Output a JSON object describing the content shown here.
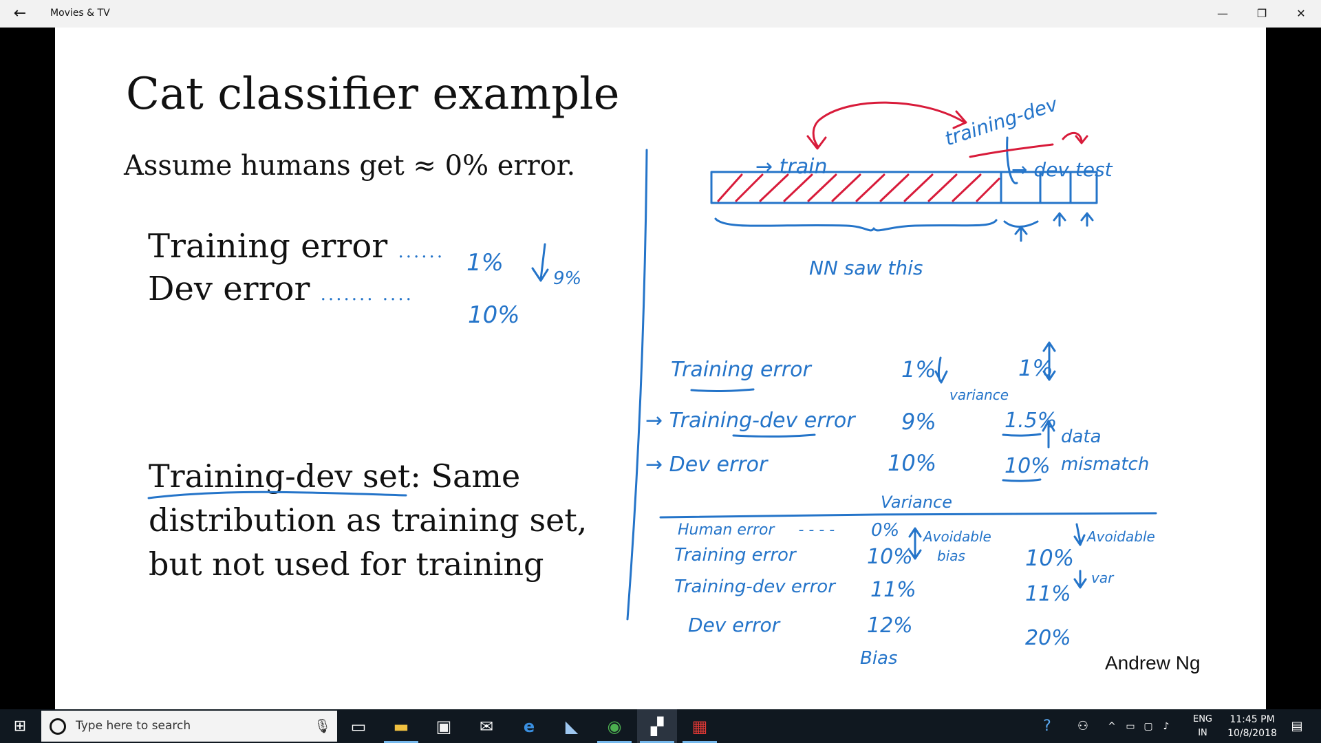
{
  "window": {
    "title": "Movies & TV",
    "back_icon": "arrow-left-icon",
    "minimize_glyph": "—",
    "maximize_glyph": "❐",
    "close_glyph": "✕"
  },
  "slide": {
    "title": "Cat classifier example",
    "assumption": "Assume humans get ≈ 0% error.",
    "training_error_label": "Training error",
    "training_error_dots": "......",
    "dev_error_label": "Dev error",
    "dev_error_dots": "....... ....",
    "training_dev_definition": "Training-dev set: Same distribution as training set, but not used for training",
    "author": "Andrew Ng"
  },
  "annotations": {
    "left": {
      "train_err": "1%",
      "dev_err": "10%",
      "gap": "9%"
    },
    "top_diagram": {
      "train": "→ train",
      "training_dev": "training-dev",
      "dev_test": "→ dev test",
      "nn_saw": "NN saw this"
    },
    "table_upper": {
      "rows": [
        "Training error",
        "→ Training-dev error",
        "→ Dev error"
      ],
      "col1": [
        "1%",
        "9%",
        "10%"
      ],
      "col2": [
        "1%",
        "1.5%",
        "10%"
      ],
      "col1_note": "variance",
      "col2_note_1": "data",
      "col2_note_2": "mismatch",
      "col1_footer": "Variance"
    },
    "table_lower": {
      "rows": [
        "Human error",
        "Training error",
        "Training-dev error",
        "Dev error"
      ],
      "human_dots": "- - - -",
      "col1": [
        "0%",
        "10%",
        "11%",
        "12%"
      ],
      "col2": [
        "10%",
        "11%",
        "20%"
      ],
      "col1_note_1": "Avoidable",
      "col1_note_2": "bias",
      "col2_note_1": "Avoidable",
      "col2_note_2": "var",
      "col1_footer": "Bias"
    }
  },
  "taskbar": {
    "search_placeholder": "Type here to search",
    "language_1": "ENG",
    "language_2": "IN",
    "time": "11:45 PM",
    "date": "10/8/2018"
  },
  "colors": {
    "ink_blue": "#2474c9",
    "ink_red": "#d81b3a",
    "taskbar": "#101820",
    "titlebar": "#f2f2f2"
  }
}
